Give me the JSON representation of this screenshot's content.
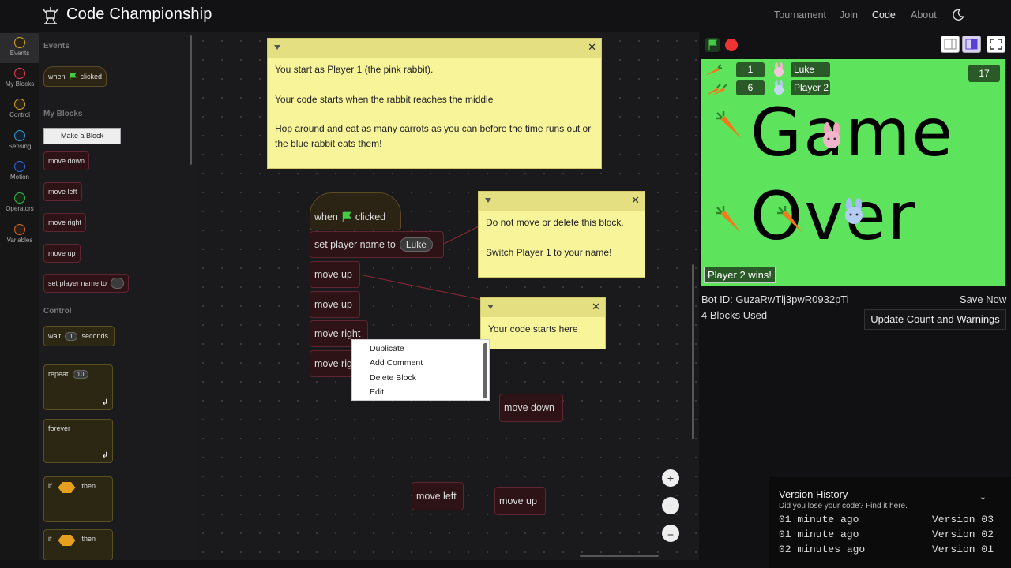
{
  "app": {
    "title": "Code Championship"
  },
  "nav": {
    "items": [
      "Tournament",
      "Join",
      "Code",
      "About"
    ],
    "active": "Code"
  },
  "categories": [
    {
      "label": "Events",
      "color": "#d4a82a"
    },
    {
      "label": "My Blocks",
      "color": "#e0455a"
    },
    {
      "label": "Control",
      "color": "#d4a82a"
    },
    {
      "label": "Sensing",
      "color": "#3a9bd4"
    },
    {
      "label": "Motion",
      "color": "#3a6bd4"
    },
    {
      "label": "Operators",
      "color": "#3ab44a"
    },
    {
      "label": "Variables",
      "color": "#d46a2a"
    }
  ],
  "flyout": {
    "events_label": "Events",
    "when_clicked": {
      "pre": "when",
      "post": "clicked"
    },
    "my_blocks_label": "My Blocks",
    "make_block": "Make a Block",
    "move_down": "move down",
    "move_left": "move left",
    "move_right": "move right",
    "move_up": "move up",
    "set_player_name": "set player name to",
    "control_label": "Control",
    "wait": {
      "pre": "wait",
      "value": "1",
      "post": "seconds"
    },
    "repeat": {
      "pre": "repeat",
      "value": "10"
    },
    "forever": "forever",
    "if_pre": "if",
    "if_then": "then"
  },
  "workspace": {
    "when_clicked": {
      "pre": "when",
      "post": "clicked"
    },
    "set_player": {
      "text": "set player name to",
      "value": "Luke"
    },
    "move_up_1": "move up",
    "move_up_2": "move up",
    "move_right_1": "move right",
    "move_right_2": "move rig",
    "loose_move_down": "move down",
    "loose_move_left": "move left",
    "loose_move_up": "move up"
  },
  "notes": {
    "intro": [
      "You start as Player 1 (the pink rabbit).",
      "Your code starts when the rabbit reaches the middle",
      "Hop around and eat as many carrots as you can before the time runs out or the blue rabbit eats them!"
    ],
    "do_not_move": [
      "Do not move or delete this block.",
      "Switch Player 1 to your name!"
    ],
    "starts_here": "Your code starts here"
  },
  "context_menu": {
    "items": [
      "Duplicate",
      "Add Comment",
      "Delete Block",
      "Edit"
    ]
  },
  "zoom": {
    "in": "+",
    "out": "−",
    "reset": "="
  },
  "stage": {
    "player1": {
      "score": "1",
      "name": "Luke"
    },
    "player2": {
      "score": "6",
      "name": "Player 2"
    },
    "timer": "17",
    "line1": "Game",
    "line2": "Over",
    "winner": "Player 2 wins!",
    "bg_color": "#5ee35c"
  },
  "info": {
    "bot_id": "Bot ID: GuzaRwTlj3pwR0932pTi",
    "blocks_used": "4 Blocks Used",
    "save_now": "Save Now",
    "update_button": "Update Count and Warnings"
  },
  "version_history": {
    "title": "Version History",
    "subtitle": "Did you lose your code? Find it here.",
    "rows": [
      {
        "time": "01 minute ago",
        "version": "Version 03"
      },
      {
        "time": "01 minute ago",
        "version": "Version 02"
      },
      {
        "time": "02 minutes ago",
        "version": "Version 01"
      }
    ]
  }
}
